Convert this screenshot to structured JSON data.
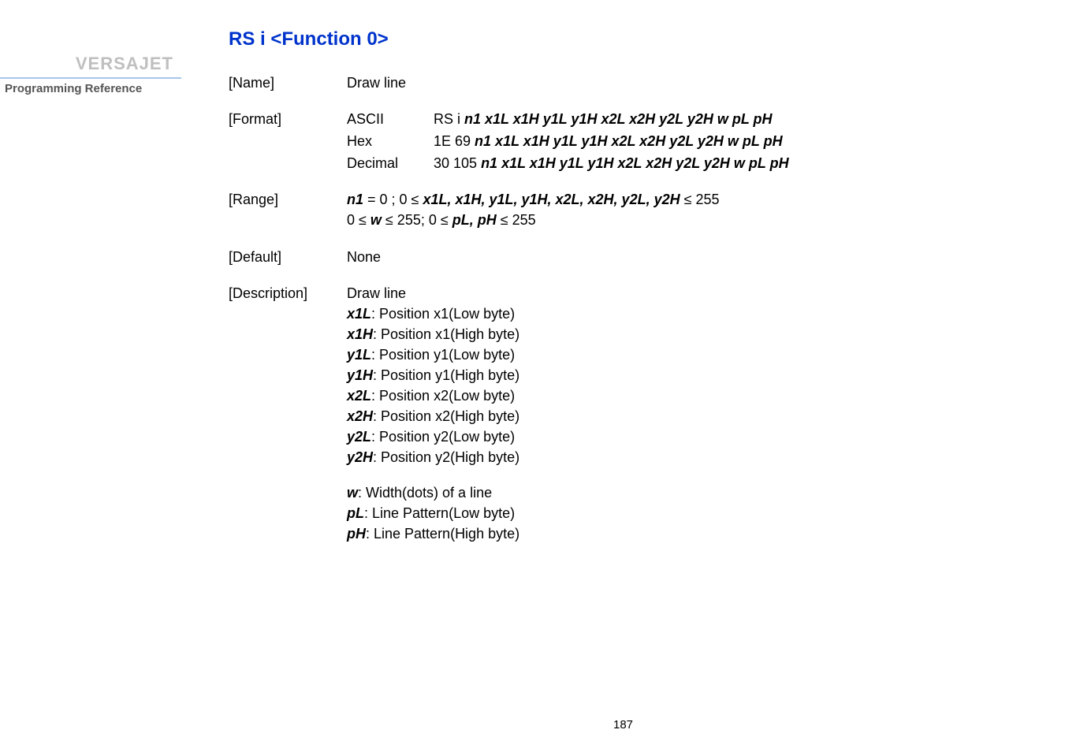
{
  "sidebar": {
    "brand": "VERSAJET",
    "ref": "Programming Reference"
  },
  "title": "RS i   <Function 0>",
  "labels": {
    "name": "[Name]",
    "format": "[Format]",
    "range": "[Range]",
    "default": "[Default]",
    "description": "[Description]"
  },
  "name_value": "Draw line",
  "format": {
    "ascii_label": "ASCII",
    "hex_label": "Hex",
    "dec_label": "Decimal",
    "ascii_prefix": "RS i   ",
    "hex_prefix": "1E 69 ",
    "dec_prefix": "30 105 ",
    "params": "n1 x1L x1H y1L y1H x2L x2H y2L y2H w pL pH"
  },
  "range": {
    "n1_eq": " = 0 ; 0 ≤ ",
    "n1": "n1",
    "mid_vars": "x1L, x1H, y1L, y1H, x2L, x2H, y2L, y2H",
    "tail": " ≤ 255",
    "line2_a": "0 ≤ ",
    "line2_w": "w",
    "line2_b": " ≤ 255; 0 ≤ ",
    "line2_pl": "pL, pH",
    "line2_c": " ≤ 255"
  },
  "default_value": "None",
  "description": {
    "head": "Draw line",
    "x1L_k": "x1L",
    "x1L_v": ": Position x1(Low byte)",
    "x1H_k": "x1H",
    "x1H_v": ": Position x1(High byte)",
    "y1L_k": "y1L",
    "y1L_v": ": Position y1(Low byte)",
    "y1H_k": "y1H",
    "y1H_v": ": Position y1(High byte)",
    "x2L_k": "x2L",
    "x2L_v": ": Position x2(Low byte)",
    "x2H_k": "x2H",
    "x2H_v": ": Position x2(High byte)",
    "y2L_k": "y2L",
    "y2L_v": ": Position y2(Low byte)",
    "y2H_k": "y2H",
    "y2H_v": ": Position y2(High byte)",
    "w_k": "w",
    "w_v": ": Width(dots) of a line",
    "pL_k": "pL",
    "pL_v": ": Line Pattern(Low byte)",
    "pH_k": "pH",
    "pH_v": ": Line Pattern(High byte)"
  },
  "page_number": "187"
}
